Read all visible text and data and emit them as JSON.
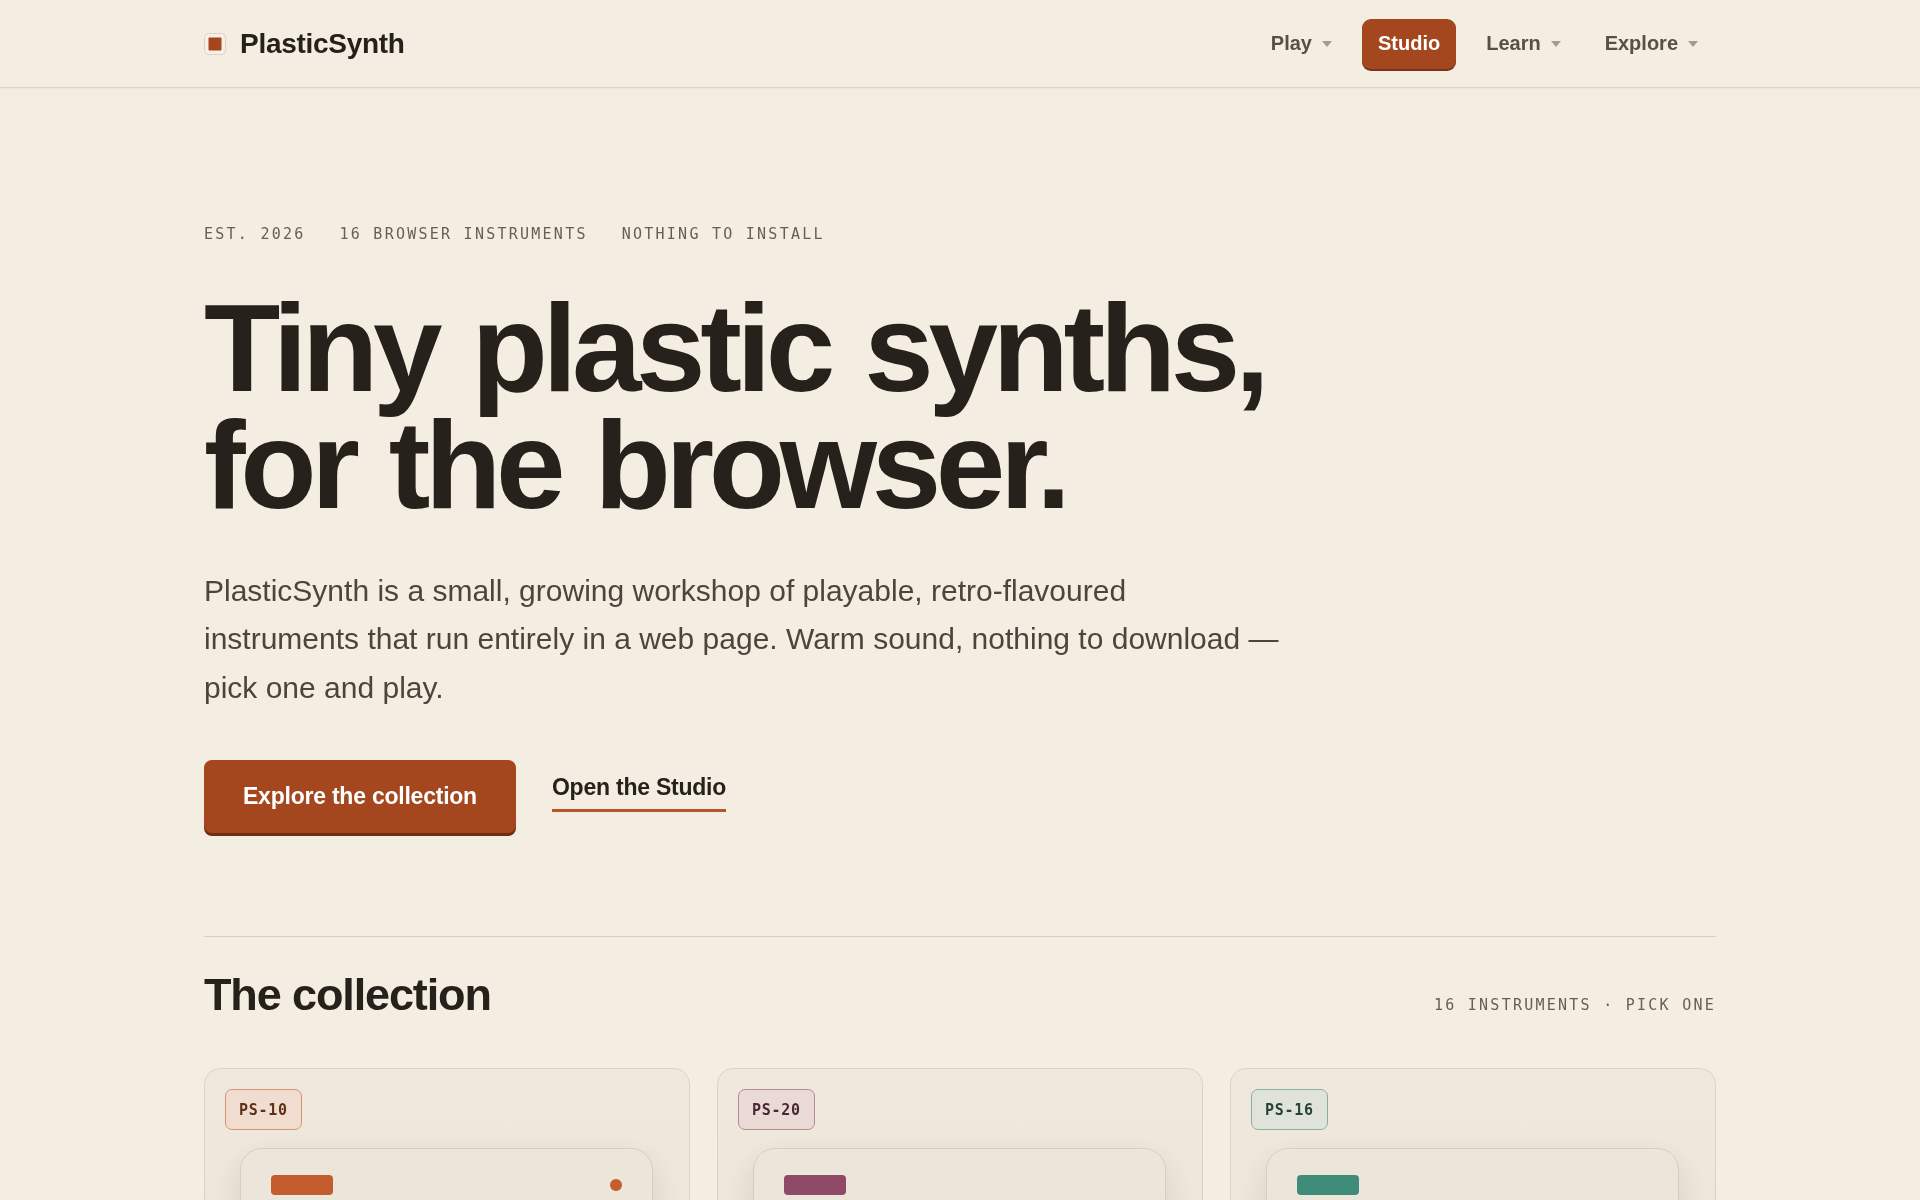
{
  "header": {
    "brand": {
      "name": "PlasticSynth"
    },
    "nav": [
      {
        "label": "Play",
        "kind": "menu"
      },
      {
        "label": "Studio",
        "kind": "button"
      },
      {
        "label": "Learn",
        "kind": "menu"
      },
      {
        "label": "Explore",
        "kind": "menu"
      }
    ]
  },
  "hero": {
    "eyebrow": [
      "EST. 2026",
      "16 BROWSER INSTRUMENTS",
      "NOTHING TO INSTALL"
    ],
    "headline": [
      "Tiny plastic synths,",
      "for the browser."
    ],
    "lede": "PlasticSynth is a small, growing workshop of playable, retro-flavoured instruments that run entirely in a web page. Warm sound, nothing to download — pick one and play.",
    "actions": [
      {
        "label": "Explore the collection",
        "kind": "primary"
      },
      {
        "label": "Open the Studio",
        "kind": "link"
      }
    ]
  },
  "collection": {
    "title": "The collection",
    "meta": "16 INSTRUMENTS · PICK ONE",
    "instruments": [
      {
        "model": "PS-10",
        "color": "#c35d2e",
        "led_on": true
      },
      {
        "model": "PS-20",
        "color": "#8f4a68",
        "led_on": false
      },
      {
        "model": "PS-16",
        "color": "#3f8c7b",
        "led_on": false
      }
    ]
  }
}
